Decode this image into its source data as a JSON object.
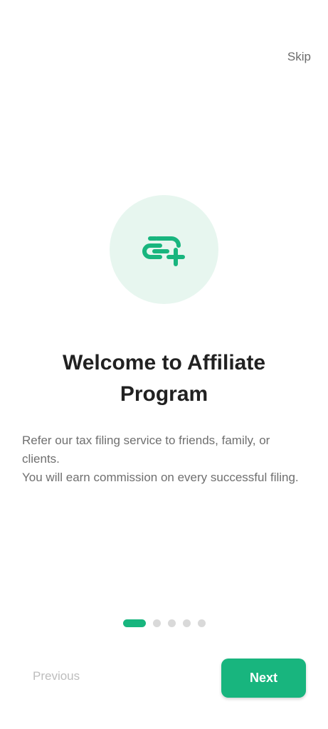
{
  "header": {
    "skip_label": "Skip"
  },
  "hero": {
    "icon": "link-plus-icon",
    "accent_color": "#18b57e",
    "circle_color": "#e7f6ef"
  },
  "content": {
    "title_line1": "Welcome to Affiliate",
    "title_line2": "Program",
    "description_line1": "Refer our tax filing service to friends, family, or clients.",
    "description_line2": "You will earn commission on every successful filing."
  },
  "pagination": {
    "current": 1,
    "total": 5
  },
  "footer": {
    "previous_label": "Previous",
    "next_label": "Next"
  }
}
